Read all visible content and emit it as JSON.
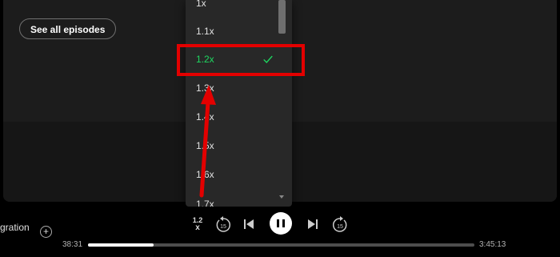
{
  "episodes": {
    "see_all_label": "See all episodes"
  },
  "speed_menu": {
    "items": [
      {
        "label": "1x",
        "selected": false
      },
      {
        "label": "1.1x",
        "selected": false
      },
      {
        "label": "1.2x",
        "selected": true
      },
      {
        "label": "1.3x",
        "selected": false
      },
      {
        "label": "1.4x",
        "selected": false
      },
      {
        "label": "1.5x",
        "selected": false
      },
      {
        "label": "1.6x",
        "selected": false
      },
      {
        "label": "1.7x",
        "selected": false
      }
    ],
    "check_icon": "check-icon",
    "selected_color": "#1ed760"
  },
  "annotation": {
    "box_color": "#e30000",
    "arrow_color": "#e30000"
  },
  "player": {
    "episode_title_fragment": "gration",
    "add_icon": "plus-circle-icon",
    "speed_value": "1.2",
    "speed_suffix": "x",
    "skip_back_seconds": "15",
    "skip_forward_seconds": "15",
    "elapsed": "38:31",
    "total": "3:45:13",
    "progress_fraction": 0.17
  }
}
